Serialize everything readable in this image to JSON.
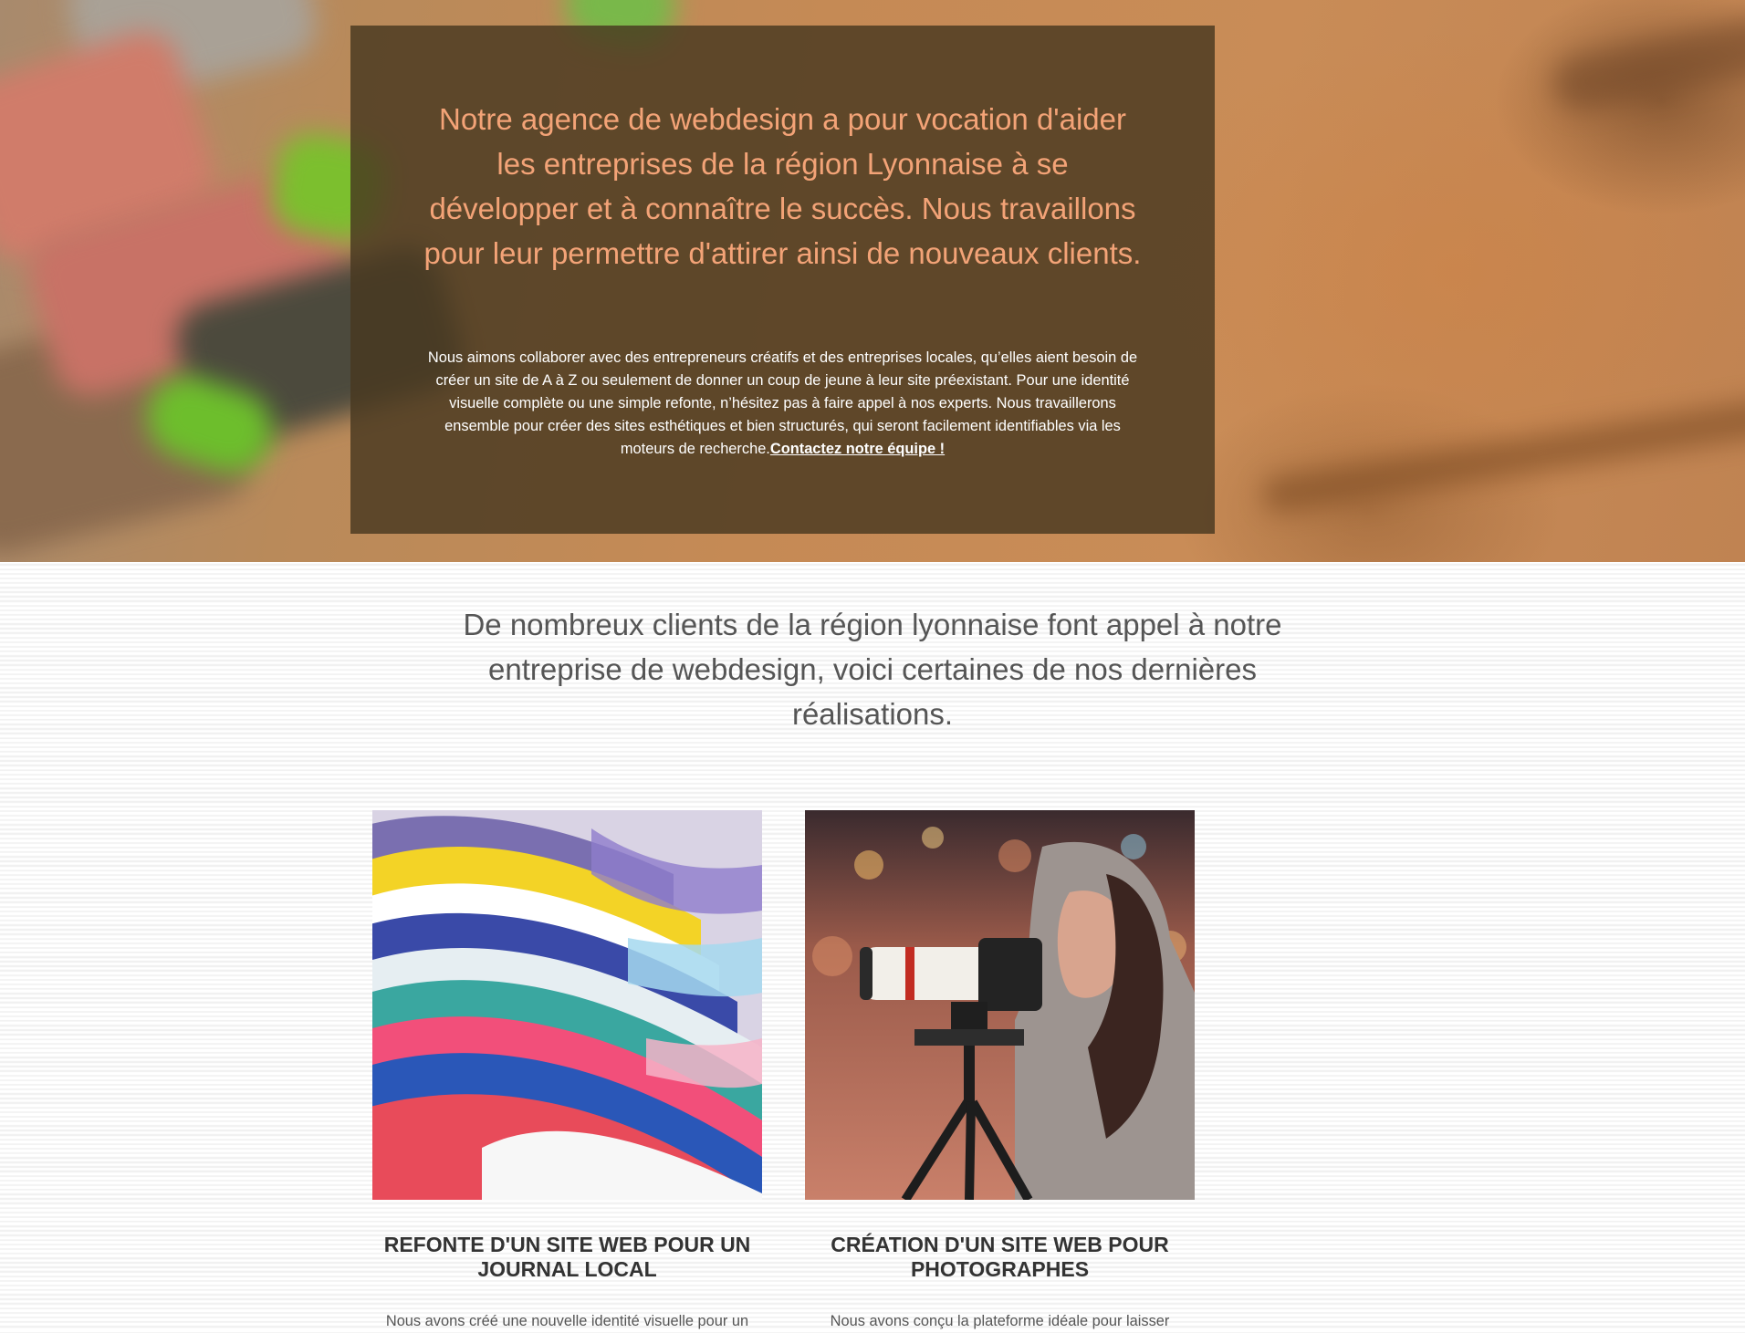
{
  "hero": {
    "heading": "Notre agence de webdesign a pour vocation d'aider les entreprises de la région Lyonnaise à se développer et à connaître le succès. Nous travaillons pour leur permettre d'attirer ainsi de nouveaux clients.",
    "paragraph": "Nous aimons collaborer avec des entrepreneurs créatifs et des entreprises locales, qu’elles aient besoin de créer un site de A à Z ou seulement de donner un coup de jeune à leur site préexistant. Pour une identité visuelle complète ou une simple refonte, n’hésitez pas à faire appel à nos experts. Nous travaillerons ensemble pour créer des sites esthétiques et bien structurés, qui seront facilement identifiables via les moteurs de recherche.",
    "link_label": "Contactez notre équipe !"
  },
  "projects_section": {
    "intro": "De nombreux clients de la région lyonnaise font appel à notre entreprise de webdesign, voici certaines de nos dernières réalisations.",
    "items": [
      {
        "image": "colorful-magazines-stack",
        "title": "Refonte d'un site web pour un journal local",
        "text": "Nous avons créé une nouvelle identité visuelle pour un"
      },
      {
        "image": "photographer-with-camera-on-tripod",
        "title": "Création d'un site web pour photographes",
        "text": "Nous avons conçu la plateforme idéale pour laisser"
      }
    ]
  },
  "colors": {
    "hero_heading": "#f3a377",
    "hero_panel": "#483820",
    "body_text": "#555555",
    "title_text": "#333333"
  }
}
